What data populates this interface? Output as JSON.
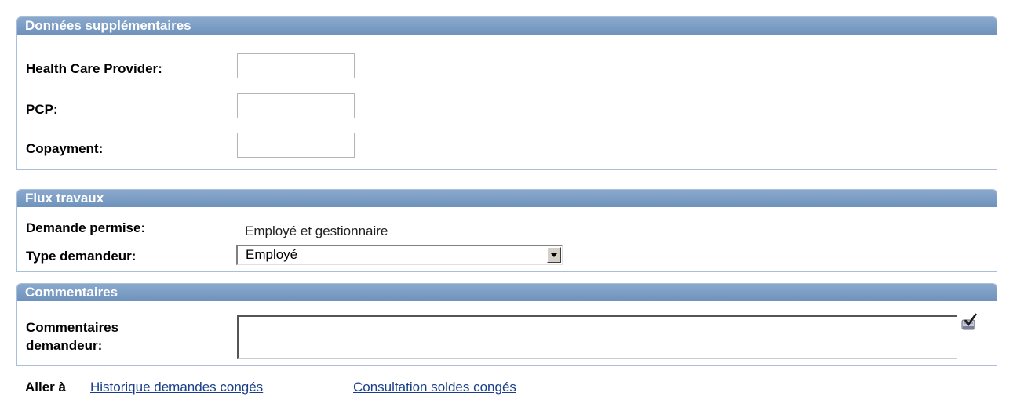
{
  "extra": {
    "title": "Données supplémentaires",
    "fields": [
      {
        "label": "Health Care Provider:",
        "value": ""
      },
      {
        "label": "PCP:",
        "value": ""
      },
      {
        "label": "Copayment:",
        "value": ""
      }
    ]
  },
  "workflow": {
    "title": "Flux travaux",
    "request_allowed_label": "Demande permise:",
    "request_allowed_value": "Employé et gestionnaire",
    "requester_type_label": "Type demandeur:",
    "requester_type_value": "Employé"
  },
  "comments": {
    "title": "Commentaires",
    "label_line1": "Commentaires",
    "label_line2": "demandeur:",
    "value": "",
    "spell_icon": "spell-check-icon"
  },
  "footer": {
    "goto_label": "Aller à",
    "links": [
      "Historique demandes congés",
      "Consultation soldes congés"
    ]
  },
  "colors": {
    "header_bg": "#7b9ec6",
    "border": "#a8bfdb",
    "link": "#1a3f8a"
  }
}
